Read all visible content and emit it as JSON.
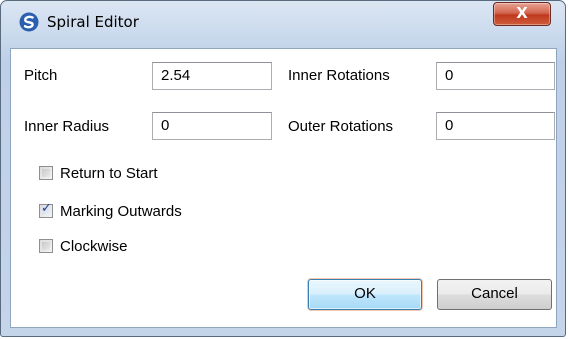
{
  "window": {
    "title": "Spiral Editor",
    "close_glyph": "X",
    "icon": "spiral-app-icon"
  },
  "fields": {
    "pitch": {
      "label": "Pitch",
      "value": "2.54"
    },
    "inner_radius": {
      "label": "Inner Radius",
      "value": "0"
    },
    "inner_rotations": {
      "label": "Inner Rotations",
      "value": "0"
    },
    "outer_rotations": {
      "label": "Outer Rotations",
      "value": "0"
    }
  },
  "checkboxes": {
    "return_to_start": {
      "label": "Return to Start",
      "checked": false
    },
    "marking_outwards": {
      "label": "Marking Outwards",
      "checked": true
    },
    "clockwise": {
      "label": "Clockwise",
      "checked": false
    }
  },
  "buttons": {
    "ok": "OK",
    "cancel": "Cancel"
  },
  "colors": {
    "titlebar": "#c8d8ec",
    "close_button": "#c0391f",
    "default_button_border": "#3c7fb1"
  }
}
